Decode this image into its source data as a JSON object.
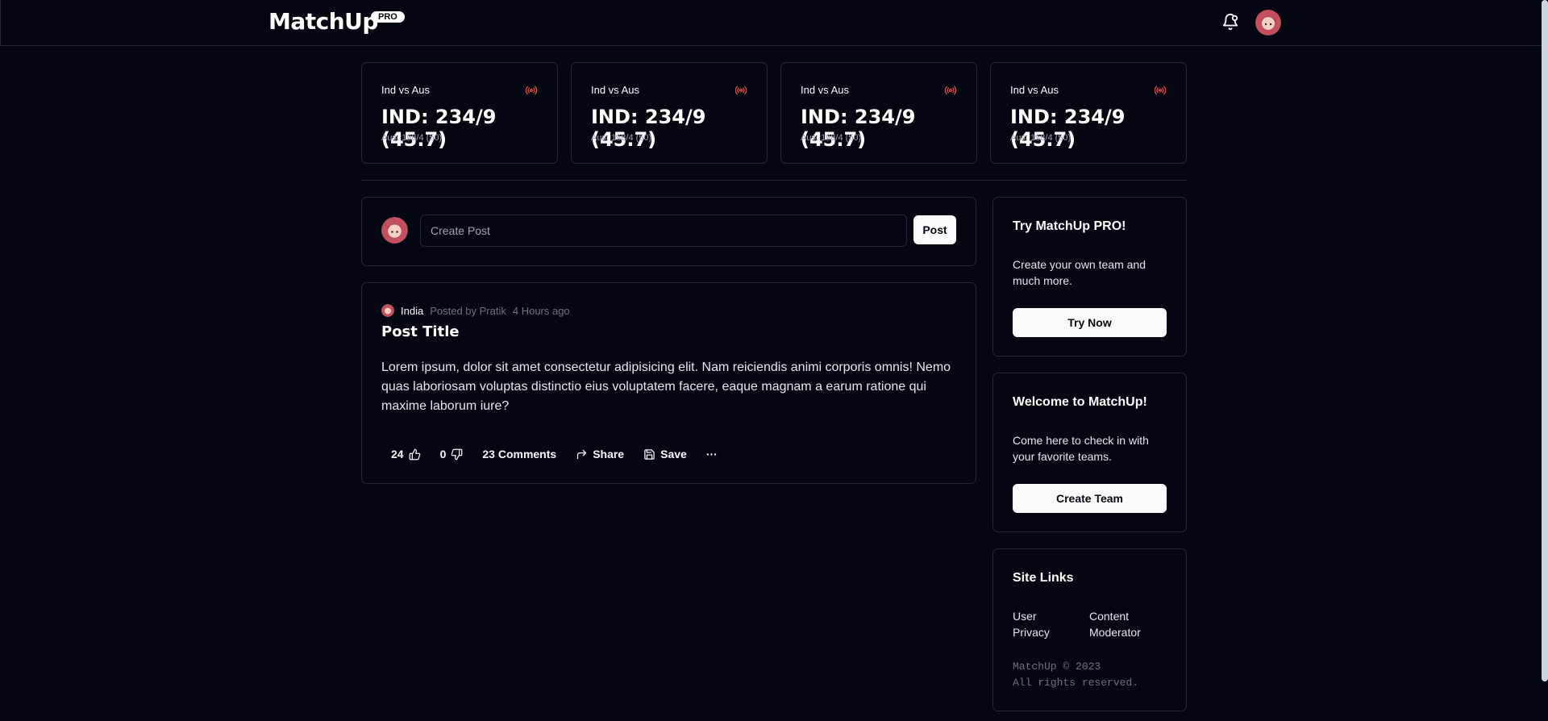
{
  "header": {
    "logo": "MatchUp",
    "badge": "PRO"
  },
  "scores": [
    {
      "match": "Ind vs Aus",
      "main": "IND: 234/9 (45.7)",
      "sub": "Aus: 198/4 (50)"
    },
    {
      "match": "Ind vs Aus",
      "main": "IND: 234/9 (45.7)",
      "sub": "Aus: 198/4 (50)"
    },
    {
      "match": "Ind vs Aus",
      "main": "IND: 234/9 (45.7)",
      "sub": "Aus: 198/4 (50)"
    },
    {
      "match": "Ind vs Aus",
      "main": "IND: 234/9 (45.7)",
      "sub": "Aus: 198/4 (50)"
    }
  ],
  "create_post": {
    "placeholder": "Create Post",
    "button": "Post"
  },
  "post": {
    "community": "India",
    "author": "Posted by Pratik",
    "time": "4 Hours ago",
    "title": "Post Title",
    "body": "Lorem ipsum, dolor sit amet consectetur adipisicing elit. Nam reiciendis animi corporis omnis! Nemo quas laboriosam voluptas distinctio eius voluptatem facere, eaque magnam a earum ratione qui maxime laborum iure?",
    "upvotes": "24",
    "downvotes": "0",
    "comments": "23 Comments",
    "share": "Share",
    "save": "Save",
    "more": "···"
  },
  "sidebar": {
    "pro": {
      "title": "Try MatchUp PRO!",
      "text": "Create your own team and much more.",
      "button": "Try Now"
    },
    "welcome": {
      "title": "Welcome to MatchUp!",
      "text": "Come here to check in with your favorite teams.",
      "button": "Create Team"
    },
    "links": {
      "title": "Site Links",
      "items": [
        "User",
        "Content",
        "Privacy",
        "Moderator"
      ],
      "copyright": "MatchUp © 2023\nAll rights reserved."
    }
  },
  "colors": {
    "background": "#030712",
    "border": "#1f2937",
    "live": "#ef4444"
  }
}
